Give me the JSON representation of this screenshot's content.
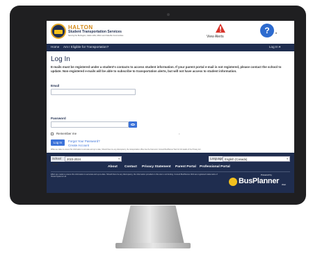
{
  "header": {
    "brand_title": "HALTON",
    "brand_subtitle": "Student Transportation Services",
    "brand_tagline": "Serving the Burlington, Halton Hills, Milton and Oakville Communities",
    "alerts_label": "View Alerts",
    "help_symbol": "?",
    "help_caret": "▾"
  },
  "nav": {
    "home": "Home",
    "eligible": "Am I Eligible for Transportation?",
    "login": "Log In ▾"
  },
  "main": {
    "title": "Log In",
    "notice": "E-mails must be registered under a student's contacts to access student information. If your parent portal e-mail is not registered, please contact the school to update. Non-registered e-mails will be able to subscribe to transportation alerts, but will not have access to student information.",
    "email_label": "Email",
    "email_value": "",
    "password_label": "Password",
    "password_value": "",
    "remember_label": "Remember me",
    "login_button": "Log In",
    "forgot_link": "Forgot Your Password?",
    "create_link": "Create Account",
    "dot": "•"
  },
  "footer": {
    "disclaimer_top": "While we make to ensure this information is accurate and up to date, Should there be any discrepancy, the transportation office has the final word. Consult BusPlanner Web for full details of the Privacy Act.",
    "school_year_caption": "School Year",
    "school_year_value": "2023-2024",
    "language_caption": "Language",
    "language_value": "English (Canada)",
    "links": [
      "About",
      "Contact",
      "Privacy Statement",
      "Parent Portal",
      "Professional Portal"
    ],
    "disclaimer_bottom": "Effort are made to ensure this information is accurate and up-to-date. Should there be any discrepancy, the information provided on this site is not binding. Consult BusPlanner Web are registered trademarks of Visual Systems Ltd.",
    "powered_by": "Powered by",
    "bp_brand": "BusPlanner",
    "bp_version": "Web"
  },
  "colors": {
    "navy": "#1f2d4f",
    "accent_blue": "#3b72d9",
    "alert_red": "#d9342b",
    "brand_gold": "#d48b1c"
  }
}
